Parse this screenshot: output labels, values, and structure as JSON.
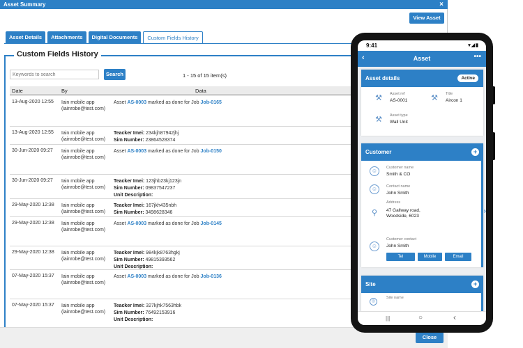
{
  "dialog": {
    "title": "Asset Summary",
    "close_icon": "×",
    "view_asset_label": "View Asset",
    "tabs": [
      {
        "label": "Asset Details"
      },
      {
        "label": "Attachments"
      },
      {
        "label": "Digital Documents"
      },
      {
        "label": "Custom Fields History"
      }
    ],
    "section_title": "Custom Fields History",
    "search_placeholder": "Keywords to search",
    "search_button": "Search",
    "pager_text": "1 - 15 of 15 item(s)",
    "columns": {
      "date": "Date",
      "by": "By",
      "data": "Data"
    },
    "close_button": "Close"
  },
  "rows": [
    {
      "date": "13-Aug-2020 12:55",
      "by1": "Iain mobile app",
      "by2": "(iainrobe@test.com)",
      "pre": "Asset ",
      "asset": "AS-0003",
      "mid": " marked as done for Job ",
      "job": "Job-0165"
    },
    {
      "date": "13-Aug-2020 12:55",
      "by1": "Iain mobile app",
      "by2": "(iainrobe@test.com)",
      "l1": "Teacker Imei:",
      "v1": " 234kjh87942jhj",
      "l2": "Sim Number:",
      "v2": " 23864528374"
    },
    {
      "date": "30-Jun-2020 09:27",
      "by1": "Iain mobile app",
      "by2": "(iainrobe@test.com)",
      "pre": "Asset ",
      "asset": "AS-0003",
      "mid": " marked as done for Job ",
      "job": "Job-0150"
    },
    {
      "date": "30-Jun-2020 09:27",
      "by1": "Iain mobile app",
      "by2": "(iainrobe@test.com)",
      "l1": "Teacker Imei:",
      "v1": " 123jhb23kj123jn",
      "l2": "Sim Number:",
      "v2": " 09837547237",
      "l3": "Unit Description:"
    },
    {
      "date": "29-May-2020 12:38",
      "by1": "Iain mobile app",
      "by2": "(iainrobe@test.com)",
      "l1": "Teacker Imei:",
      "v1": " 167jkh435nbh",
      "l2": "Sim Number:",
      "v2": " 3498628346"
    },
    {
      "date": "29-May-2020 12:38",
      "by1": "Iain mobile app",
      "by2": "(iainrobe@test.com)",
      "pre": "Asset ",
      "asset": "AS-0003",
      "mid": " marked as done for Job ",
      "job": "Job-0145"
    },
    {
      "date": "29-May-2020 12:38",
      "by1": "Iain mobile app",
      "by2": "(iainrobe@test.com)",
      "l1": "Teacker Imei:",
      "v1": " 984kjk8763hgkj",
      "l2": "Sim Number:",
      "v2": " 49815393562",
      "l3": "Unit Description:"
    },
    {
      "date": "07-May-2020 15:37",
      "by1": "Iain mobile app",
      "by2": "(iainrobe@test.com)",
      "pre": "Asset ",
      "asset": "AS-0003",
      "mid": " marked as done for Job ",
      "job": "Job-0136"
    },
    {
      "date": "07-May-2020 15:37",
      "by1": "Iain mobile app",
      "by2": "(iainrobe@test.com)",
      "l1": "Teacker Imei:",
      "v1": " 327kjhk7563hbk",
      "l2": "Sim Number:",
      "v2": " 76492153916",
      "l3": "Unit Description:"
    }
  ],
  "phone": {
    "time": "9:41",
    "status_icons": "▾◢▮",
    "back_icon": "‹",
    "title": "Asset",
    "more_icon": "•••",
    "asset_details": {
      "heading": "Asset details",
      "status": "Active",
      "ref_label": "Asset ref",
      "ref_value": "AS-0001",
      "title_label": "Title",
      "title_value": "Aircon 1",
      "type_label": "Asset type",
      "type_value": "Wall Unit"
    },
    "customer": {
      "heading": "Customer",
      "name_label": "Customer name",
      "name_value": "Smith & CO",
      "contact_label": "Contact name",
      "contact_value": "John Smith",
      "address_label": "Address",
      "address_line1": "47 Gallway road,",
      "address_line2": "Woodside, 6023",
      "cust_contact_label": "Customer contact",
      "cust_contact_value": "John Smith",
      "tel": "Tel",
      "mobile": "Mobile",
      "email": "Email"
    },
    "site": {
      "heading": "Site",
      "name_label": "Site name"
    },
    "plus_icon": "+",
    "nav_recent": "|||",
    "nav_home": "○",
    "nav_back": "‹",
    "chevron_right": "›"
  }
}
